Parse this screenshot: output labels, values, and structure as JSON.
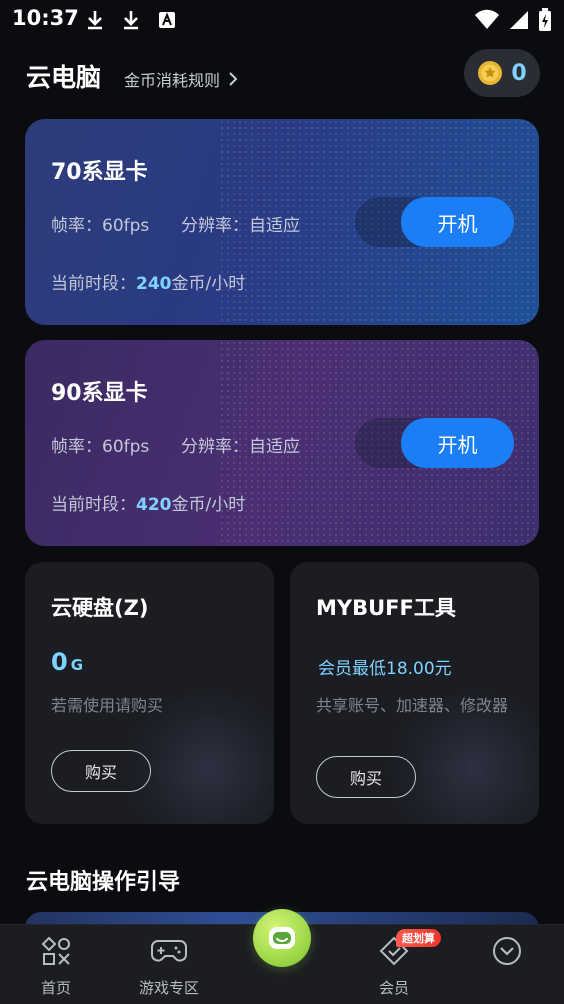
{
  "status_bar": {
    "time": "10:37"
  },
  "header": {
    "title": "云电脑",
    "rules_link": "金币消耗规则",
    "coin_balance": "0"
  },
  "gpu_cards": [
    {
      "name": "70系显卡",
      "fps_label": "帧率：60fps",
      "resolution_label": "分辨率：自适应",
      "period_prefix": "当前时段：",
      "price_value": "240",
      "price_unit": "金币/小时",
      "button": "开机"
    },
    {
      "name": "90系显卡",
      "fps_label": "帧率：60fps",
      "resolution_label": "分辨率：自适应",
      "period_prefix": "当前时段：",
      "price_value": "420",
      "price_unit": "金币/小时",
      "button": "开机"
    }
  ],
  "disk_card": {
    "title": "云硬盘(Z)",
    "amount": "0",
    "unit": "G",
    "desc": "若需使用请购买",
    "button": "购买"
  },
  "tool_card": {
    "title": "MYBUFF工具",
    "price": "会员最低18.00元",
    "desc": "共享账号、加速器、修改器",
    "button": "购买"
  },
  "guide": {
    "title": "云电脑操作引导"
  },
  "bottom_nav": {
    "items": [
      {
        "label": "首页"
      },
      {
        "label": "游戏专区"
      },
      {
        "label": ""
      },
      {
        "label": "会员",
        "badge": "超划算"
      },
      {
        "label": ""
      }
    ]
  },
  "colors": {
    "accent": "#1b7ef5",
    "highlight": "#7fd2ff",
    "badge": "#e8342a",
    "background": "#0b0c0f"
  }
}
